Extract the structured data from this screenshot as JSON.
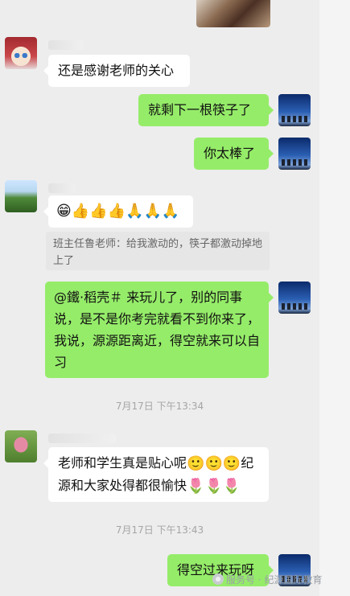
{
  "messages": [
    {
      "id": "m1",
      "side": "left",
      "text": "还是感谢老师的关心"
    },
    {
      "id": "m2",
      "side": "right",
      "text": "就剩下一根筷子了"
    },
    {
      "id": "m3",
      "side": "right",
      "text": "你太棒了"
    },
    {
      "id": "m4",
      "side": "left",
      "emojis": [
        "😁",
        "👍",
        "👍",
        "👍",
        "🙏",
        "🙏",
        "🙏"
      ]
    },
    {
      "id": "m4q",
      "quote": "班主任鲁老师：给我激动的，筷子都激动掉地上了"
    },
    {
      "id": "m5",
      "side": "right",
      "text": "@鐵·稻壳＃ 来玩儿了，别的同事说，是不是你考完就看不到你来了，我说，源源距离近，得空就来可以自习"
    },
    {
      "id": "t1",
      "time": "7月17日 下午13:34"
    },
    {
      "id": "m6",
      "side": "left",
      "text_a": "老师和学生真是贴心呢",
      "emoji_a": [
        "🙂",
        "🙂",
        "🙂"
      ],
      "text_b": "纪源和大家处得都很愉快",
      "emoji_b": [
        "🌷",
        "🌷",
        "🌷"
      ]
    },
    {
      "id": "t2",
      "time": "7月17日 下午13:43"
    },
    {
      "id": "m7",
      "side": "right",
      "text": "得空过来玩呀"
    }
  ],
  "watermark": {
    "text": "服务号 · 纪源国际教育",
    "icon": "service-account-icon"
  }
}
